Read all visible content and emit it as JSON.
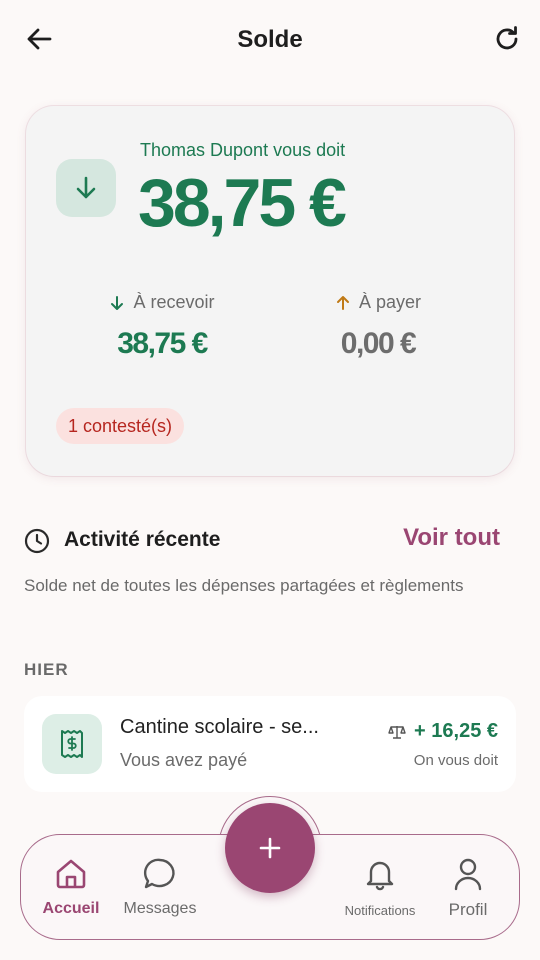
{
  "header": {
    "title": "Solde"
  },
  "balance": {
    "owes_label": "Thomas Dupont vous doit",
    "amount": "38,75 €",
    "receive_label": "À recevoir",
    "receive_amount": "38,75 €",
    "pay_label": "À payer",
    "pay_amount": "0,00 €",
    "contested_badge": "1 contesté(s)"
  },
  "activity": {
    "title": "Activité récente",
    "see_all": "Voir tout",
    "description": "Solde net de toutes les dépenses partagées et règlements",
    "section_label": "HIER",
    "items": [
      {
        "title": "Cantine scolaire - se...",
        "subtitle": "Vous avez payé",
        "amount": "+ 16,25 €",
        "note": "On vous doit",
        "icon": "receipt-icon"
      }
    ]
  },
  "nav": {
    "items": [
      {
        "label": "Accueil",
        "icon": "home-icon",
        "active": true
      },
      {
        "label": "Messages",
        "icon": "chat-icon"
      },
      {
        "label": "Notifications",
        "icon": "bell-icon"
      },
      {
        "label": "Profil",
        "icon": "user-icon"
      }
    ],
    "fab_icon": "plus-icon"
  },
  "colors": {
    "accent": "#9a4672",
    "positive": "#1d7a52",
    "contested": "#b6261f",
    "pay_arrow": "#c07a16"
  }
}
